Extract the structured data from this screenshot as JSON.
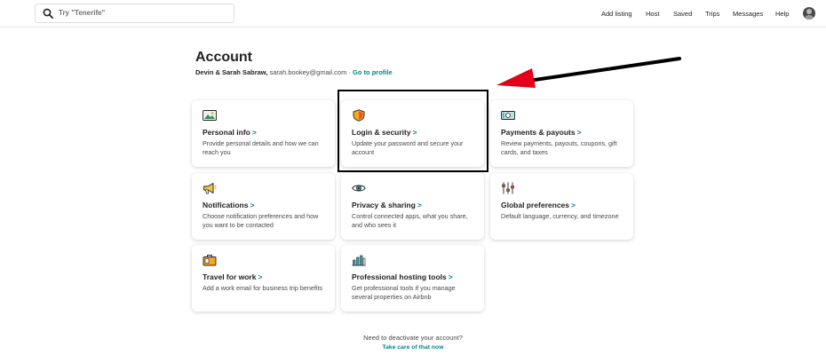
{
  "header": {
    "search_placeholder": "Try \"Tenerife\"",
    "nav": [
      "Add listing",
      "Host",
      "Saved",
      "Trips",
      "Messages",
      "Help"
    ]
  },
  "account": {
    "title": "Account",
    "user_name": "Devin & Sarah Sabraw,",
    "email": "sarah.bookey@gmail.com",
    "separator": "·",
    "profile_link": "Go to profile"
  },
  "cards": [
    {
      "title": "Personal info",
      "chevron": ">",
      "desc": "Provide personal details and how we can reach you",
      "icon": "id-card-icon"
    },
    {
      "title": "Login & security",
      "chevron": ">",
      "desc": "Update your password and secure your account",
      "icon": "shield-icon"
    },
    {
      "title": "Payments & payouts",
      "chevron": ">",
      "desc": "Review payments, payouts, coupons, gift cards, and taxes",
      "icon": "money-icon"
    },
    {
      "title": "Notifications",
      "chevron": ">",
      "desc": "Choose notification preferences and how you want to be contacted",
      "icon": "megaphone-icon"
    },
    {
      "title": "Privacy & sharing",
      "chevron": ">",
      "desc": "Control connected apps, what you share, and who sees it",
      "icon": "eye-icon"
    },
    {
      "title": "Global preferences",
      "chevron": ">",
      "desc": "Default language, currency, and timezone",
      "icon": "sliders-icon"
    },
    {
      "title": "Travel for work",
      "chevron": ">",
      "desc": "Add a work email for business trip benefits",
      "icon": "briefcase-icon"
    },
    {
      "title": "Professional hosting tools",
      "chevron": ">",
      "desc": "Get professional tools if you manage several properties on Airbnb",
      "icon": "chart-icon"
    }
  ],
  "footer": {
    "question": "Need to deactivate your account?",
    "link": "Take care of that now"
  },
  "colors": {
    "accent": "#008489",
    "annotation_arrow": "#e3001b",
    "annotation_box": "#000000"
  }
}
